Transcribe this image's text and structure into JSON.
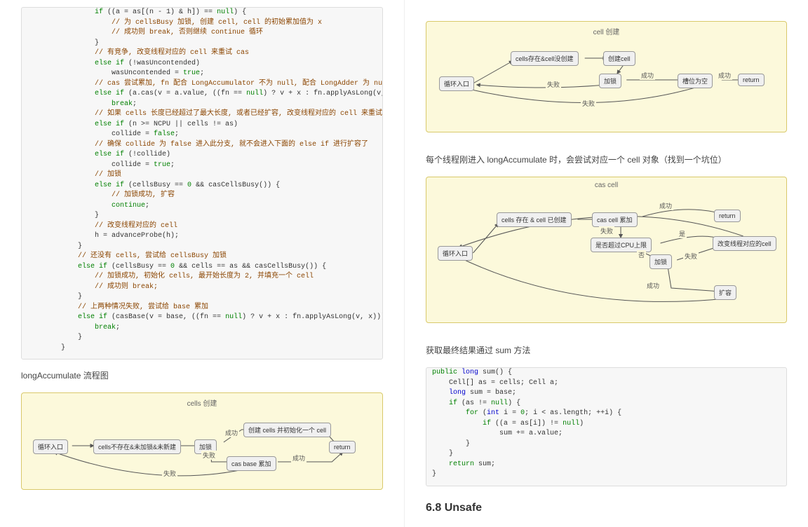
{
  "left": {
    "code": [
      {
        "i": 2,
        "k": "kw",
        "t": "if"
      },
      {
        "i": 2,
        "t": " ((a = as[(n - 1) & h]) == "
      },
      {
        "k": "kw",
        "t": "null"
      },
      {
        "t": ") {"
      },
      {
        "br": 1
      },
      {
        "i": 3,
        "k": "cm",
        "t": "// 为 cellsBusy 加锁, 创建 cell, cell 的初始累加值为 x"
      },
      {
        "br": 1
      },
      {
        "i": 3,
        "k": "cm",
        "t": "// 成功则 break, 否则继续 continue 循环"
      },
      {
        "br": 1
      },
      {
        "i": 2,
        "t": "}"
      },
      {
        "br": 1
      },
      {
        "i": 2,
        "k": "cm",
        "t": "// 有竞争, 改变线程对应的 cell 来重试 cas"
      },
      {
        "br": 1
      },
      {
        "i": 2,
        "k": "kw",
        "t": "else if"
      },
      {
        "t": " (!wasUncontended)"
      },
      {
        "br": 1
      },
      {
        "i": 3,
        "t": "wasUncontended = "
      },
      {
        "k": "kw",
        "t": "true"
      },
      {
        "t": ";"
      },
      {
        "br": 1
      },
      {
        "i": 2,
        "k": "cm",
        "t": "// cas 尝试累加, fn 配合 LongAccumulator 不为 null, 配合 LongAdder 为 null"
      },
      {
        "br": 1
      },
      {
        "i": 2,
        "k": "kw",
        "t": "else if"
      },
      {
        "t": " (a.cas(v = a.value, ((fn == "
      },
      {
        "k": "kw",
        "t": "null"
      },
      {
        "t": ") ? v + x : fn.applyAsLong(v, x))))"
      },
      {
        "br": 1
      },
      {
        "i": 3,
        "k": "kw",
        "t": "break"
      },
      {
        "t": ";"
      },
      {
        "br": 1
      },
      {
        "i": 2,
        "k": "cm",
        "t": "// 如果 cells 长度已经超过了最大长度, 或者已经扩容, 改变线程对应的 cell 来重试 cas"
      },
      {
        "br": 1
      },
      {
        "i": 2,
        "k": "kw",
        "t": "else if"
      },
      {
        "t": " (n >= NCPU || cells != as)"
      },
      {
        "br": 1
      },
      {
        "i": 3,
        "t": "collide = "
      },
      {
        "k": "kw",
        "t": "false"
      },
      {
        "t": ";"
      },
      {
        "br": 1
      },
      {
        "i": 2,
        "k": "cm",
        "t": "// 确保 collide 为 false 进入此分支, 就不会进入下面的 else if 进行扩容了"
      },
      {
        "br": 1
      },
      {
        "i": 2,
        "k": "kw",
        "t": "else if"
      },
      {
        "t": " (!collide)"
      },
      {
        "br": 1
      },
      {
        "i": 3,
        "t": "collide = "
      },
      {
        "k": "kw",
        "t": "true"
      },
      {
        "t": ";"
      },
      {
        "br": 1
      },
      {
        "i": 2,
        "k": "cm",
        "t": "// 加锁"
      },
      {
        "br": 1
      },
      {
        "i": 2,
        "k": "kw",
        "t": "else if"
      },
      {
        "t": " (cellsBusy == "
      },
      {
        "k": "kw",
        "t": "0"
      },
      {
        "t": " && casCellsBusy()) {"
      },
      {
        "br": 1
      },
      {
        "i": 3,
        "k": "cm",
        "t": "// 加锁成功, 扩容"
      },
      {
        "br": 1
      },
      {
        "i": 3,
        "k": "kw",
        "t": "continue"
      },
      {
        "t": ";"
      },
      {
        "br": 1
      },
      {
        "i": 2,
        "t": "}"
      },
      {
        "br": 1
      },
      {
        "i": 2,
        "k": "cm",
        "t": "// 改变线程对应的 cell"
      },
      {
        "br": 1
      },
      {
        "i": 2,
        "t": "h = advanceProbe(h);"
      },
      {
        "br": 1
      },
      {
        "i": 1,
        "t": "}"
      },
      {
        "br": 1
      },
      {
        "i": 1,
        "k": "cm",
        "t": "// 还没有 cells, 尝试给 cellsBusy 加锁"
      },
      {
        "br": 1
      },
      {
        "i": 1,
        "k": "kw",
        "t": "else if"
      },
      {
        "t": " (cellsBusy == "
      },
      {
        "k": "kw",
        "t": "0"
      },
      {
        "t": " && cells == as && casCellsBusy()) {"
      },
      {
        "br": 1
      },
      {
        "i": 2,
        "k": "cm",
        "t": "// 加锁成功, 初始化 cells, 最开始长度为 2, 并填充一个 cell"
      },
      {
        "br": 1
      },
      {
        "i": 2,
        "k": "cm",
        "t": "// 成功则 break;"
      },
      {
        "br": 1
      },
      {
        "i": 1,
        "t": "}"
      },
      {
        "br": 1
      },
      {
        "i": 1,
        "k": "cm",
        "t": "// 上两种情况失败, 尝试给 base 累加"
      },
      {
        "br": 1
      },
      {
        "i": 1,
        "k": "kw",
        "t": "else if"
      },
      {
        "t": " (casBase(v = base, ((fn == "
      },
      {
        "k": "kw",
        "t": "null"
      },
      {
        "t": ") ? v + x : fn.applyAsLong(v, x))))"
      },
      {
        "br": 1
      },
      {
        "i": 2,
        "k": "kw",
        "t": "break"
      },
      {
        "t": ";"
      },
      {
        "br": 1
      },
      {
        "i": 0,
        "t": "    }"
      },
      {
        "br": 1
      },
      {
        "i": 0,
        "t": "}"
      }
    ],
    "caption": "longAccumulate 流程图",
    "flowA": {
      "title": "cells 创建",
      "nodes": {
        "n1": "循环入口",
        "n2": "cells不存在&未加锁&未新建",
        "n3": "加锁",
        "n4": "创建 cells 并初始化一个 cell",
        "n5": "cas base 累加",
        "n6": "return"
      },
      "edges": {
        "e1": "成功",
        "e2": "失败",
        "e3": "失败",
        "e4": "成功"
      }
    }
  },
  "right": {
    "flowB": {
      "title": "cell 创建",
      "nodes": {
        "n1": "循环入口",
        "n2": "cells存在&cell没创建",
        "n3": "创建cell",
        "n4": "加锁",
        "n5": "槽位为空",
        "n6": "return"
      },
      "edges": {
        "e1": "成功",
        "e2": "成功",
        "e3": "失败",
        "e4": "失败"
      }
    },
    "para1": "每个线程刚进入 longAccumulate 时，会尝试对应一个 cell 对象（找到一个坑位）",
    "flowC": {
      "title": "cas cell",
      "nodes": {
        "n1": "循环入口",
        "n2": "cells 存在 & cell 已创建",
        "n3": "cas cell 累加",
        "n4": "return",
        "n5": "是否超过CPU上限",
        "n6": "加锁",
        "n7": "改变线程对应的cell",
        "n8": "扩容"
      },
      "edges": {
        "e_succ": "成功",
        "e_fail": "失败",
        "e_yes": "是",
        "e_no": "否"
      }
    },
    "para2": "获取最终结果通过 sum 方法",
    "code": [
      {
        "i": 0,
        "k": "kw",
        "t": "public"
      },
      {
        "t": " "
      },
      {
        "k": "tp",
        "t": "long"
      },
      {
        "t": " sum() {"
      },
      {
        "br": 1
      },
      {
        "i": 1,
        "t": "Cell[] as = cells; Cell a;"
      },
      {
        "br": 1
      },
      {
        "i": 1,
        "k": "tp",
        "t": "long"
      },
      {
        "t": " sum = base;"
      },
      {
        "br": 1
      },
      {
        "i": 1,
        "k": "kw",
        "t": "if"
      },
      {
        "t": " (as != "
      },
      {
        "k": "kw",
        "t": "null"
      },
      {
        "t": ") {"
      },
      {
        "br": 1
      },
      {
        "i": 2,
        "k": "kw",
        "t": "for"
      },
      {
        "t": " ("
      },
      {
        "k": "tp",
        "t": "int"
      },
      {
        "t": " i = "
      },
      {
        "k": "kw",
        "t": "0"
      },
      {
        "t": "; i < as.length; ++i) {"
      },
      {
        "br": 1
      },
      {
        "i": 3,
        "k": "kw",
        "t": "if"
      },
      {
        "t": " ((a = as[i]) != "
      },
      {
        "k": "kw",
        "t": "null"
      },
      {
        "t": ")"
      },
      {
        "br": 1
      },
      {
        "i": 4,
        "t": "sum += a.value;"
      },
      {
        "br": 1
      },
      {
        "i": 2,
        "t": "}"
      },
      {
        "br": 1
      },
      {
        "i": 1,
        "t": "}"
      },
      {
        "br": 1
      },
      {
        "i": 1,
        "k": "kw",
        "t": "return"
      },
      {
        "t": " sum;"
      },
      {
        "br": 1
      },
      {
        "i": 0,
        "t": "}"
      }
    ],
    "heading": "6.8 Unsafe"
  }
}
